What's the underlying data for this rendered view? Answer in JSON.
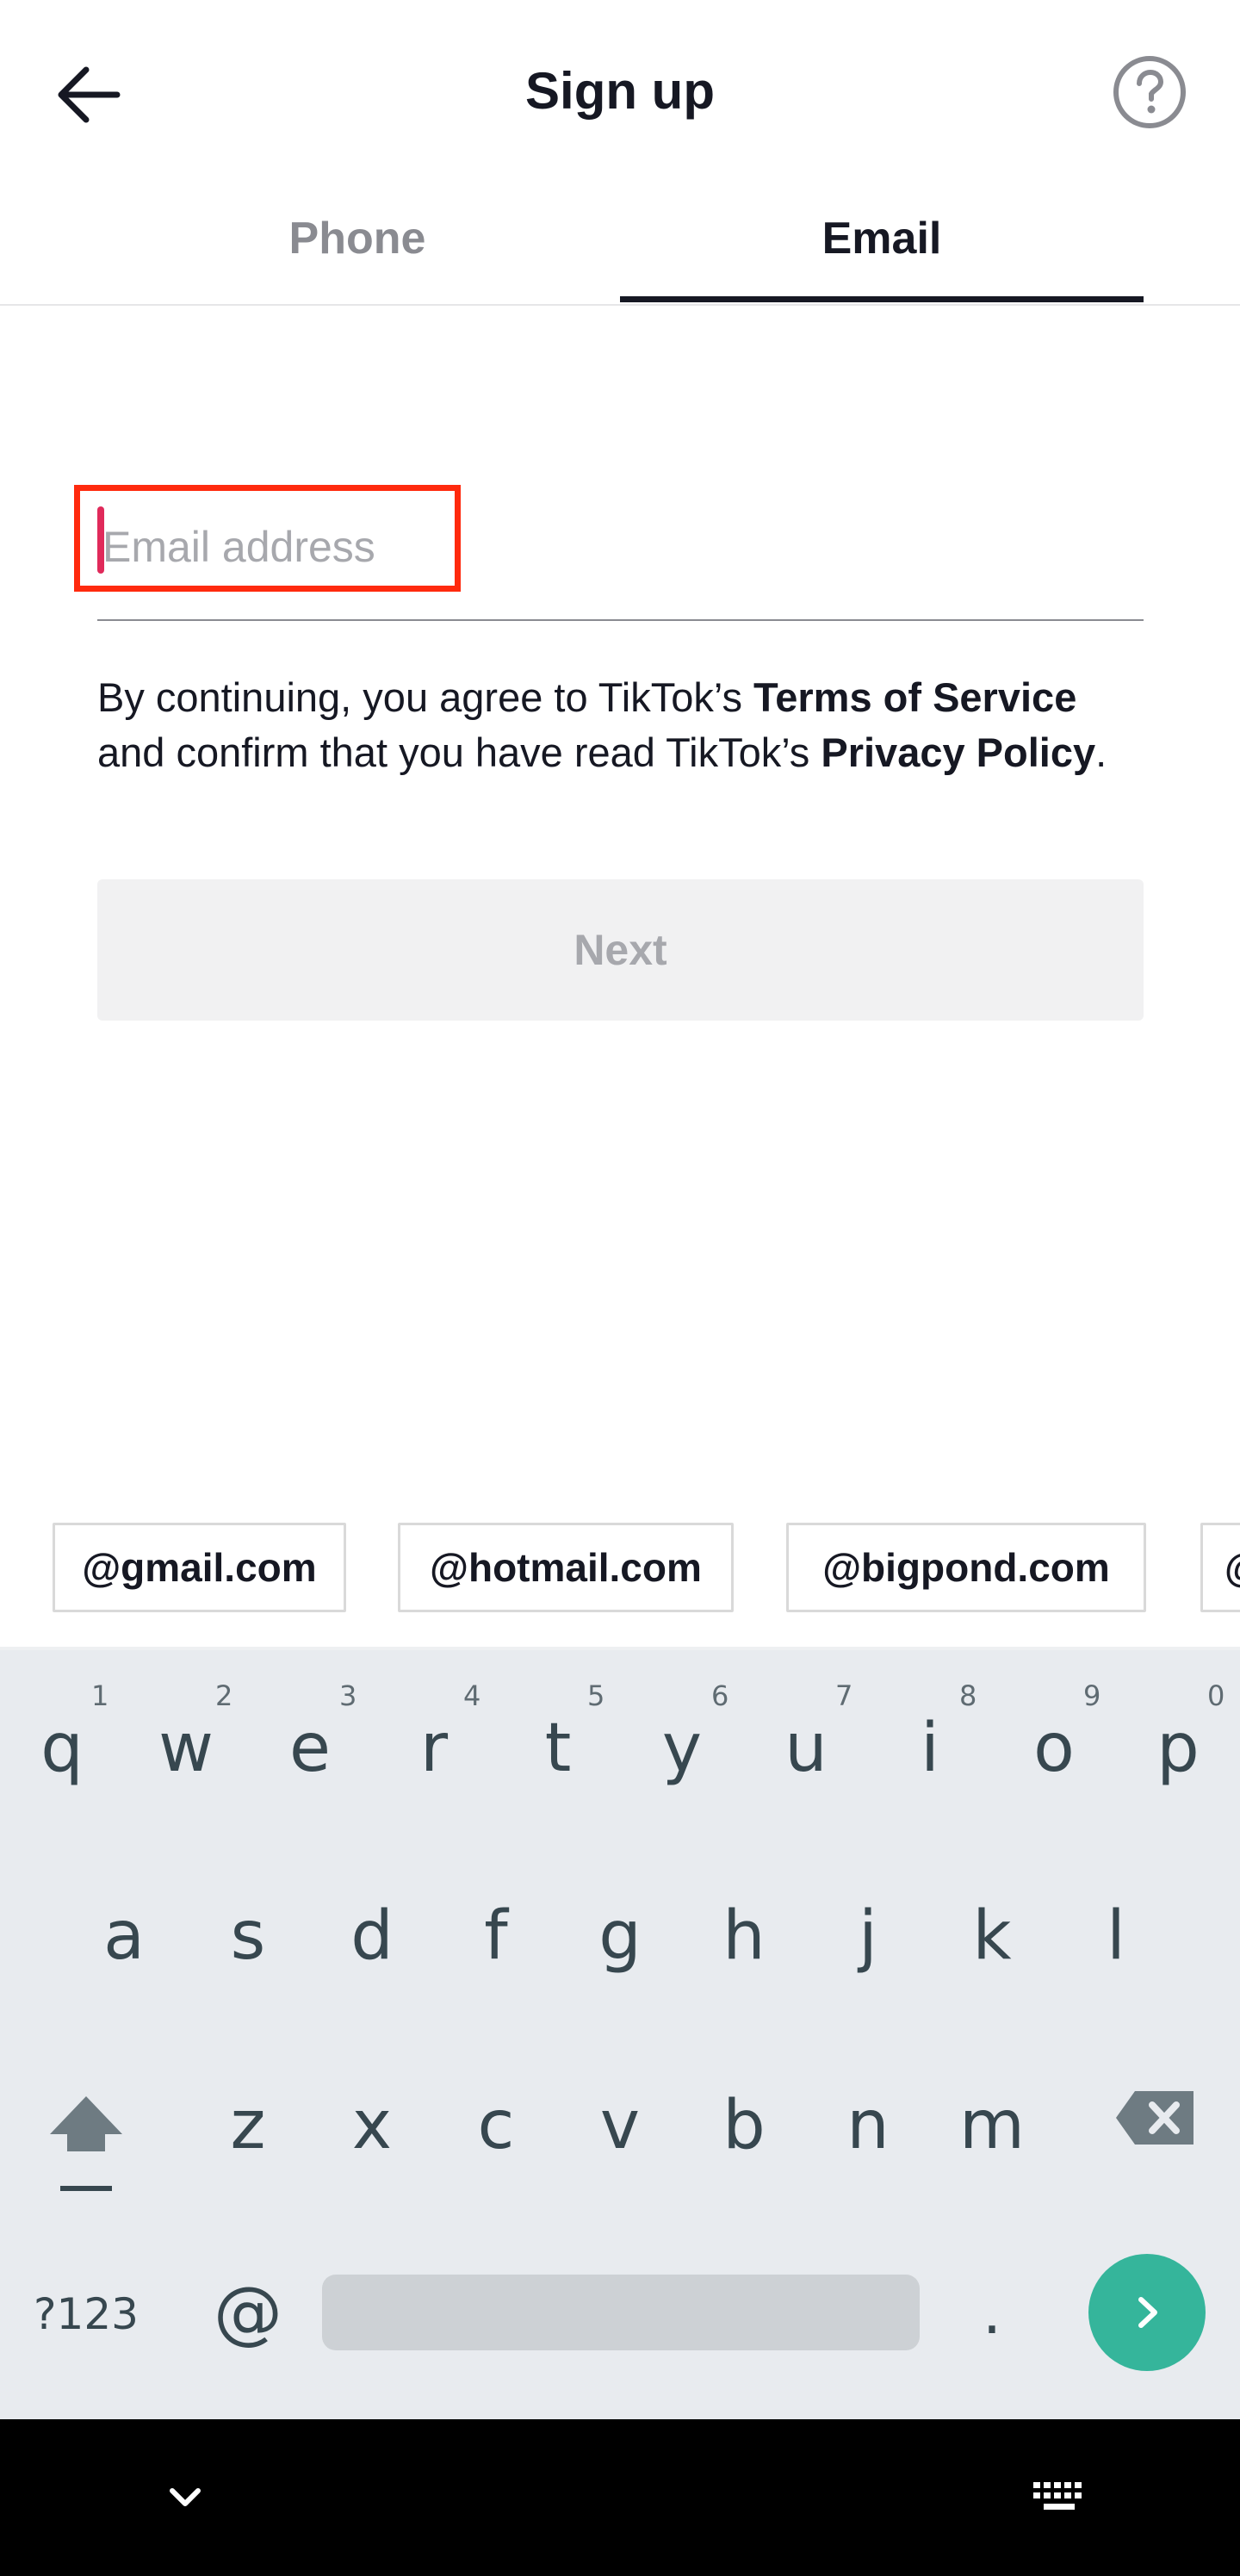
{
  "header": {
    "title": "Sign up"
  },
  "tabs": [
    {
      "label": "Phone",
      "active": false
    },
    {
      "label": "Email",
      "active": true
    }
  ],
  "email_field": {
    "placeholder": "Email address",
    "value": ""
  },
  "terms": {
    "prefix": "By continuing, you agree to TikTok’s ",
    "terms_link": "Terms of Service",
    "middle": " and confirm that you have read TikTok’s ",
    "privacy_link": "Privacy Policy",
    "suffix": "."
  },
  "next_button": {
    "label": "Next"
  },
  "email_suggestions": [
    "@gmail.com",
    "@hotmail.com",
    "@bigpond.com",
    "@"
  ],
  "keyboard": {
    "row1": [
      {
        "key": "q",
        "hint": "1"
      },
      {
        "key": "w",
        "hint": "2"
      },
      {
        "key": "e",
        "hint": "3"
      },
      {
        "key": "r",
        "hint": "4"
      },
      {
        "key": "t",
        "hint": "5"
      },
      {
        "key": "y",
        "hint": "6"
      },
      {
        "key": "u",
        "hint": "7"
      },
      {
        "key": "i",
        "hint": "8"
      },
      {
        "key": "o",
        "hint": "9"
      },
      {
        "key": "p",
        "hint": "0"
      }
    ],
    "row2": [
      "a",
      "s",
      "d",
      "f",
      "g",
      "h",
      "j",
      "k",
      "l"
    ],
    "row3": [
      "z",
      "x",
      "c",
      "v",
      "b",
      "n",
      "m"
    ],
    "symbols_key": "?123",
    "at_key": "@",
    "period_key": "."
  },
  "colors": {
    "text_primary": "#161823",
    "text_secondary": "#8a8b91",
    "caret": "#e02a5a",
    "highlight": "#ff2a0e",
    "button_disabled_bg": "#f1f1f2",
    "keyboard_bg": "#e8ebef",
    "enter_key": "#35b59b"
  },
  "icons": {
    "back": "arrow-left-icon",
    "help": "question-circle-icon",
    "shift": "shift-icon",
    "backspace": "backspace-icon",
    "enter": "chevron-right-icon",
    "nav_hide": "chevron-down-icon",
    "nav_keyboard": "keyboard-icon"
  }
}
